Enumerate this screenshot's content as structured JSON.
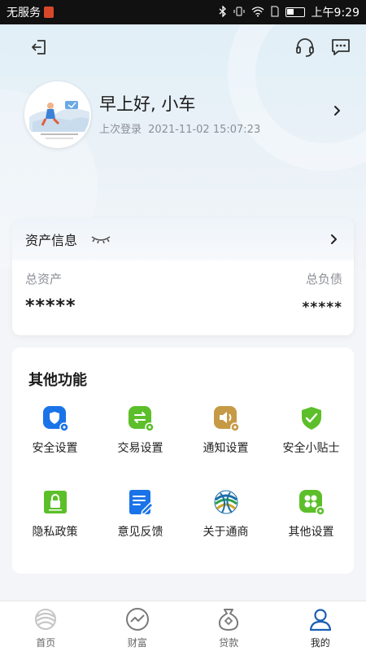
{
  "status_bar": {
    "carrier": "无服务",
    "time": "上午9:29"
  },
  "header": {
    "left_icon": "logout-icon",
    "right_icons": [
      "headset-icon",
      "message-icon"
    ]
  },
  "profile": {
    "greeting": "早上好, 小车",
    "last_login_label": "上次登录",
    "last_login_time": "2021-11-02 15:07:23"
  },
  "assets": {
    "title": "资产信息",
    "total_assets_label": "总资产",
    "total_liabilities_label": "总负债",
    "total_assets_value": "*****",
    "total_liabilities_value": "*****"
  },
  "functions": {
    "title": "其他功能",
    "items": [
      {
        "label": "安全设置",
        "icon": "shield-icon",
        "color": "#1a73e8"
      },
      {
        "label": "交易设置",
        "icon": "exchange-icon",
        "color": "#5cbf2a"
      },
      {
        "label": "通知设置",
        "icon": "speaker-icon",
        "color": "#c69a45"
      },
      {
        "label": "安全小贴士",
        "icon": "shield-check-icon",
        "color": "#5cbf2a"
      },
      {
        "label": "隐私政策",
        "icon": "lock-icon",
        "color": "#5cbf2a"
      },
      {
        "label": "意见反馈",
        "icon": "feedback-icon",
        "color": "#1a73e8"
      },
      {
        "label": "关于通商",
        "icon": "globe-logo-icon",
        "color": "#1a6fa8"
      },
      {
        "label": "其他设置",
        "icon": "apps-icon",
        "color": "#5cbf2a"
      }
    ]
  },
  "bottom_nav": {
    "items": [
      {
        "label": "首页",
        "icon": "home-logo-icon"
      },
      {
        "label": "财富",
        "icon": "wealth-icon"
      },
      {
        "label": "贷款",
        "icon": "loan-bag-icon"
      },
      {
        "label": "我的",
        "icon": "person-icon"
      }
    ],
    "active_index": 3,
    "active_color": "#1a5fb4"
  }
}
